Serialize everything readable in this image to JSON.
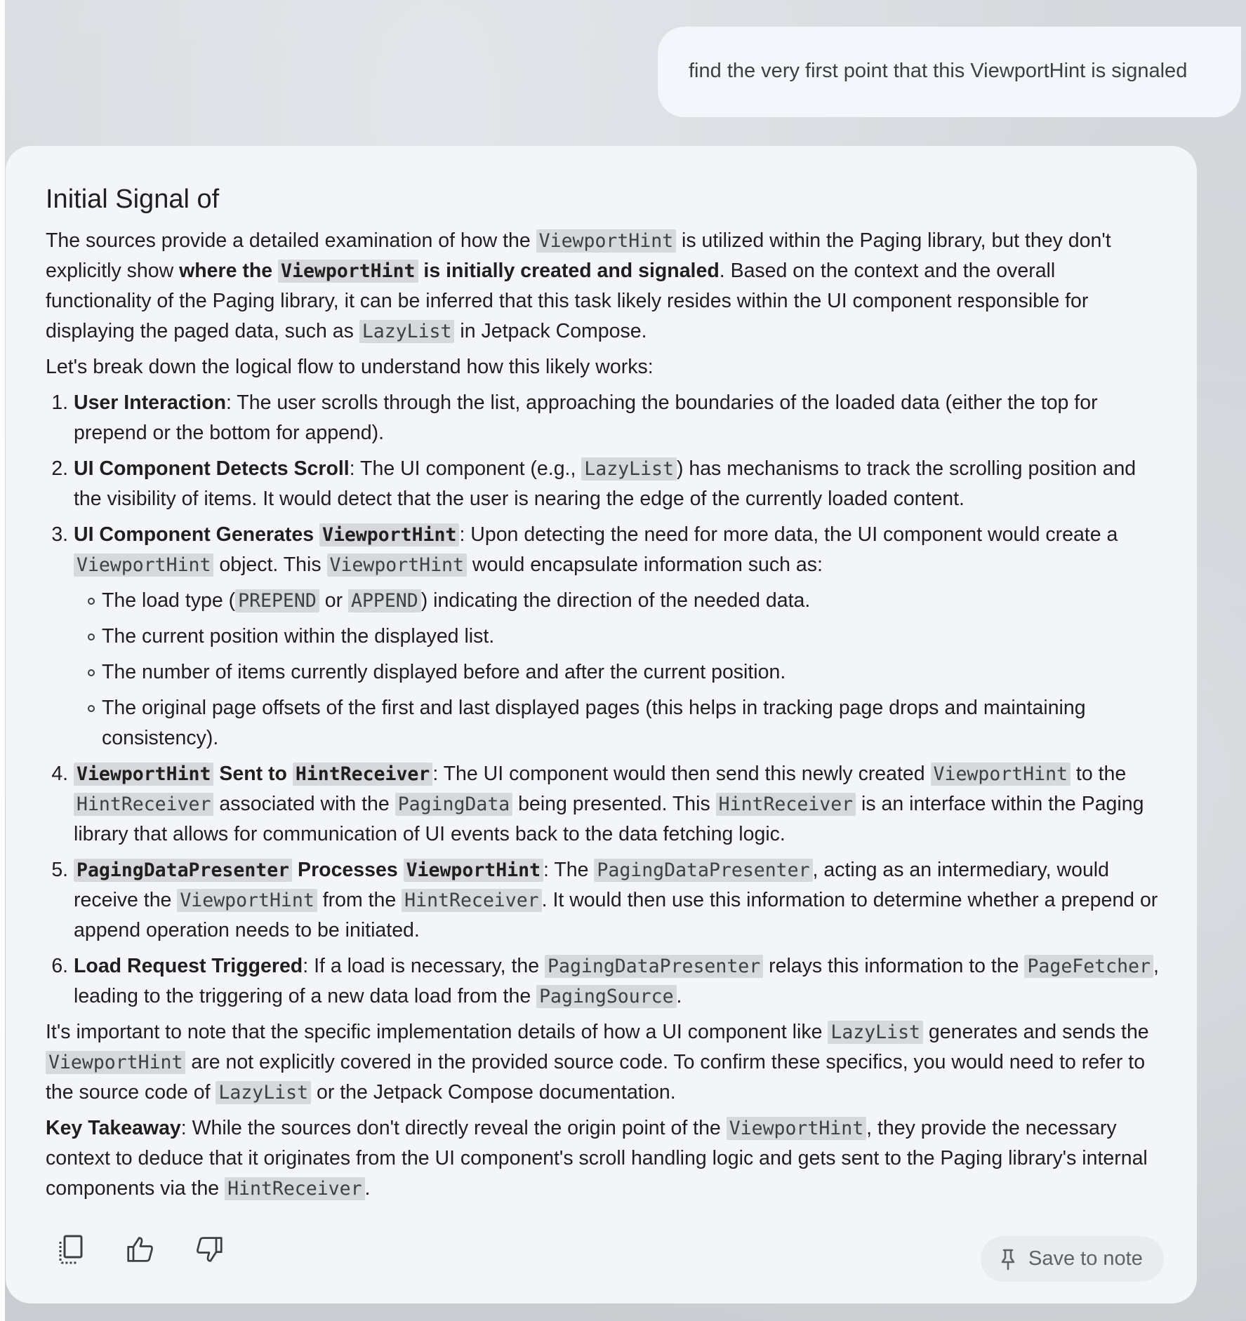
{
  "user_message": "find the very first point that this ViewportHint is signaled",
  "response": {
    "title": "Initial Signal of",
    "intro": {
      "t1": "The sources provide a detailed examination of how the ",
      "c1": "ViewportHint",
      "t2": " is utilized within the Paging library, but they don't explicitly show ",
      "b1": "where the ",
      "bc1": "ViewportHint",
      "b2": " is initially created and signaled",
      "t3": ". Based on the context and the overall functionality of the Paging library, it can be inferred that this task likely resides within the UI component responsible for displaying the paged data, such as ",
      "c2": "LazyList",
      "t4": " in Jetpack Compose."
    },
    "lead": "Let's break down the logical flow to understand how this likely works:",
    "steps": {
      "s1": {
        "bold": "User Interaction",
        "text": ": The user scrolls through the list, approaching the boundaries of the loaded data (either the top for prepend or the bottom for append)."
      },
      "s2": {
        "bold": "UI Component Detects Scroll",
        "t1": ": The UI component (e.g., ",
        "c1": "LazyList",
        "t2": ") has mechanisms to track the scrolling position and the visibility of items. It would detect that the user is nearing the edge of the currently loaded content."
      },
      "s3": {
        "bold": "UI Component Generates ",
        "bc": "ViewportHint",
        "t1": ": Upon detecting the need for more data, the UI component would create a ",
        "c1": "ViewportHint",
        "t2": " object. This ",
        "c2": "ViewportHint",
        "t3": " would encapsulate information such as:",
        "sub1": {
          "t1": "The load type (",
          "c1": "PREPEND",
          "t2": " or ",
          "c2": "APPEND",
          "t3": ") indicating the direction of the needed data."
        },
        "sub2": "The current position within the displayed list.",
        "sub3": "The number of items currently displayed before and after the current position.",
        "sub4": "The original page offsets of the first and last displayed pages (this helps in tracking page drops and maintaining consistency)."
      },
      "s4": {
        "bc1": "ViewportHint",
        "b1": " Sent to ",
        "bc2": "HintReceiver",
        "t1": ": The UI component would then send this newly created ",
        "c1": "ViewportHint",
        "t2": " to the ",
        "c2": "HintReceiver",
        "t3": " associated with the ",
        "c3": "PagingData",
        "t4": " being presented. This ",
        "c4": "HintReceiver",
        "t5": " is an interface within the Paging library that allows for communication of UI events back to the data fetching logic."
      },
      "s5": {
        "bc1": "PagingDataPresenter",
        "b1": " Processes ",
        "bc2": "ViewportHint",
        "t1": ": The ",
        "c1": "PagingDataPresenter",
        "t2": ", acting as an intermediary, would receive the ",
        "c2": "ViewportHint",
        "t3": " from the ",
        "c3": "HintReceiver",
        "t4": ". It would then use this information to determine whether a prepend or append operation needs to be initiated."
      },
      "s6": {
        "bold": "Load Request Triggered",
        "t1": ": If a load is necessary, the ",
        "c1": "PagingDataPresenter",
        "t2": " relays this information to the ",
        "c2": "PageFetcher",
        "t3": ", leading to the triggering of a new data load from the ",
        "c3": "PagingSource",
        "t4": "."
      }
    },
    "note": {
      "t1": "It's important to note that the specific implementation details of how a UI component like ",
      "c1": "LazyList",
      "t2": " generates and sends the ",
      "c2": "ViewportHint",
      "t3": " are not explicitly covered in the provided source code. To confirm these specifics, you would need to refer to the source code of ",
      "c3": "LazyList",
      "t4": " or the Jetpack Compose documentation."
    },
    "takeaway": {
      "bold": "Key Takeaway",
      "t1": ": While the sources don't directly reveal the origin point of the ",
      "c1": "ViewportHint",
      "t2": ", they provide the necessary context to deduce that it originates from the UI component's scroll handling logic and gets sent to the Paging library's internal components via the ",
      "c2": "HintReceiver",
      "t3": "."
    }
  },
  "actions": {
    "copy_icon": "copy-icon",
    "thumbs_up_icon": "thumbs-up-icon",
    "thumbs_down_icon": "thumbs-down-icon",
    "save_icon": "pin-icon",
    "save_label": "Save to note"
  },
  "colors": {
    "card_bg": "#f3f5f8",
    "user_bubble_bg": "#f3f6fb",
    "code_bg": "#d6d8db",
    "text": "#1f1f1f"
  }
}
